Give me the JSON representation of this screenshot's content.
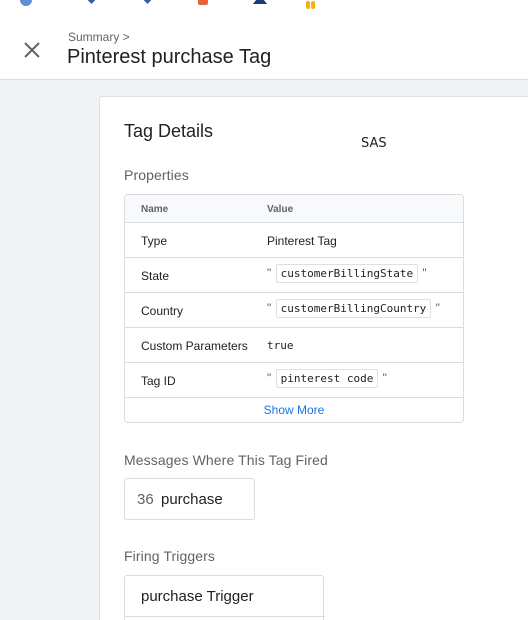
{
  "header": {
    "breadcrumb": "Summary >",
    "title": "Pinterest purchase Tag"
  },
  "favicons": [
    "blue-circle-icon",
    "blue-diamond-icon",
    "blue-diamond-icon",
    "orange-icon",
    "navy-triangle-icon",
    "yellow-bars-icon"
  ],
  "card": {
    "title": "Tag Details",
    "annotation": "SAS",
    "properties_label": "Properties",
    "table": {
      "headers": [
        "Name",
        "Value"
      ],
      "rows": [
        {
          "name": "Type",
          "value": "Pinterest Tag"
        },
        {
          "name": "State",
          "value": "customerBillingState"
        },
        {
          "name": "Country",
          "value": "customerBillingCountry"
        },
        {
          "name": "Custom Parameters",
          "value": "true"
        },
        {
          "name": "Tag ID",
          "value": "pinterest code"
        }
      ],
      "quote_open": "\"",
      "quote_close": "\"",
      "show_more": "Show More"
    },
    "messages_label": "Messages Where This Tag Fired",
    "message": {
      "number": "36",
      "event": "purchase"
    },
    "triggers_label": "Firing Triggers",
    "trigger": "purchase Trigger"
  },
  "colors": {
    "accent": "#1a73e8",
    "background": "#f1f3f4"
  }
}
